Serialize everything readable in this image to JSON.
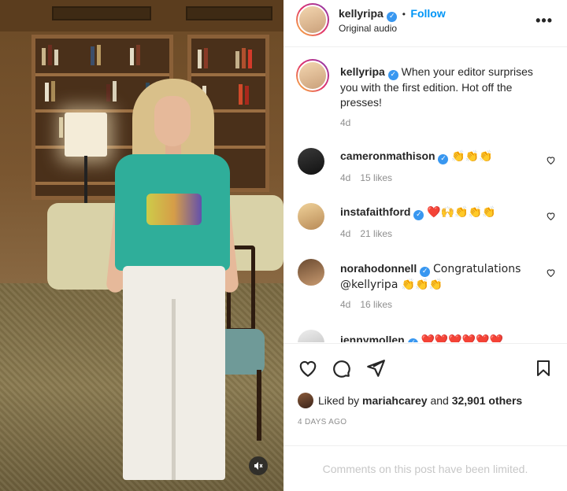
{
  "post": {
    "author": "kellyripa",
    "follow_label": "Follow",
    "separator": "•",
    "audio": "Original audio",
    "more_icon": "more-options-icon",
    "caption": "When your editor surprises you with the first edition. Hot off the presses!",
    "caption_time": "4d"
  },
  "comments": [
    {
      "user": "cameronmathison",
      "text": "👏👏👏",
      "time": "4d",
      "likes": "15 likes"
    },
    {
      "user": "instafaithford",
      "text": "❤️🙌👏👏👏",
      "time": "4d",
      "likes": "21 likes"
    },
    {
      "user": "norahodonnell",
      "text": "Congratulations @kellyripa 👏👏👏",
      "time": "4d",
      "likes": "16 likes"
    },
    {
      "user": "jennymollen",
      "text": "❤️❤️❤️❤️❤️❤️",
      "time": "",
      "likes": ""
    }
  ],
  "actions": {
    "icons": [
      "heart-icon",
      "comment-icon",
      "share-icon",
      "bookmark-icon"
    ],
    "liked_prefix": "Liked by",
    "liked_user": "mariahcarey",
    "liked_conj": "and",
    "liked_others": "32,901 others",
    "date": "4 DAYS AGO"
  },
  "footer": {
    "limited": "Comments on this post have been limited."
  },
  "colors": {
    "accent": "#0095f6",
    "verified": "#3897f0",
    "heart": "#ed4956"
  }
}
